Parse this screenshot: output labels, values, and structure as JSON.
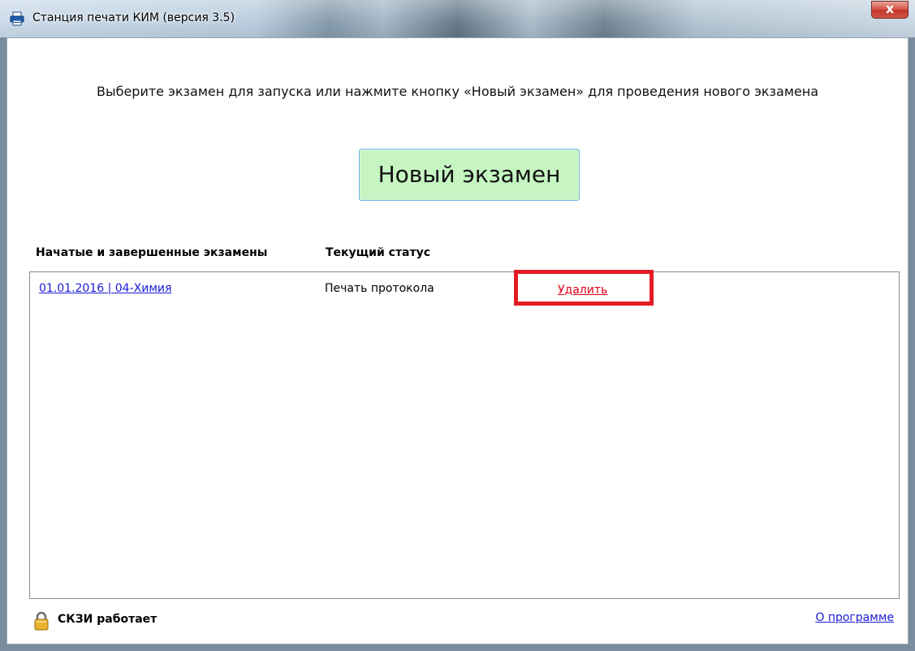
{
  "window": {
    "title": "Станция печати КИМ (версия 3.5)",
    "close_label": "x"
  },
  "main": {
    "instruction": "Выберите экзамен для запуска или нажмите кнопку «Новый экзамен» для проведения нового экзамена",
    "new_exam_button": "Новый экзамен",
    "columns": {
      "exams": "Начатые и завершенные экзамены",
      "status": "Текущий статус"
    },
    "rows": [
      {
        "exam": "01.01.2016 | 04-Химия",
        "status": "Печать протокола",
        "delete": "Удалить"
      }
    ]
  },
  "footer": {
    "status_text": "СКЗИ работает",
    "about_link": "О программе"
  },
  "colors": {
    "new_exam_button_bg": "#c6f5c1",
    "link": "#1a1ad6",
    "delete_link": "#e0001a",
    "highlight_frame": "#e21c24"
  },
  "icons": {
    "app": "printer-icon",
    "lock": "lock-icon",
    "close": "close-icon"
  }
}
